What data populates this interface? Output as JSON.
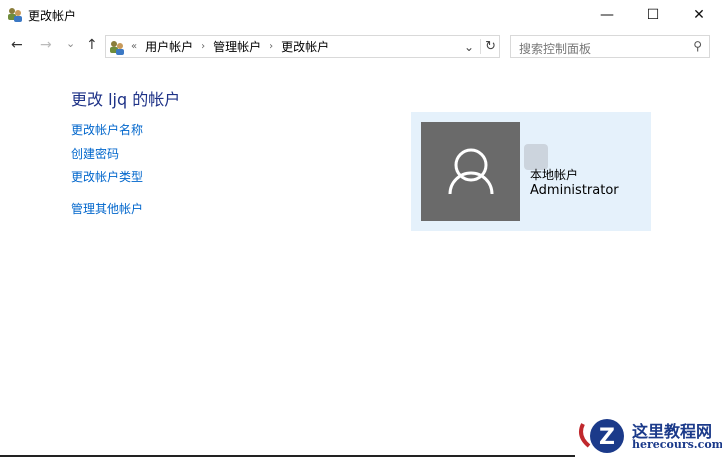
{
  "window": {
    "title": "更改帐户",
    "minimize": "—",
    "maximize": "☐",
    "close": "✕"
  },
  "nav": {
    "back": "←",
    "forward": "→",
    "recent": "⌄",
    "up": "↑"
  },
  "address": {
    "overflow": "«",
    "crumbs": [
      "用户帐户",
      "管理帐户",
      "更改帐户"
    ],
    "sep": "›",
    "dropdown": "⌄",
    "refresh": "↻"
  },
  "search": {
    "placeholder": "搜索控制面板",
    "icon": "⚲"
  },
  "main": {
    "heading": "更改 ljq 的帐户",
    "links": [
      "更改帐户名称",
      "创建密码",
      "更改帐户类型",
      "管理其他帐户"
    ]
  },
  "account": {
    "type": "本地帐户",
    "name": "Administrator"
  },
  "watermark": {
    "title": "这里教程网",
    "sub": "herecours.com"
  }
}
